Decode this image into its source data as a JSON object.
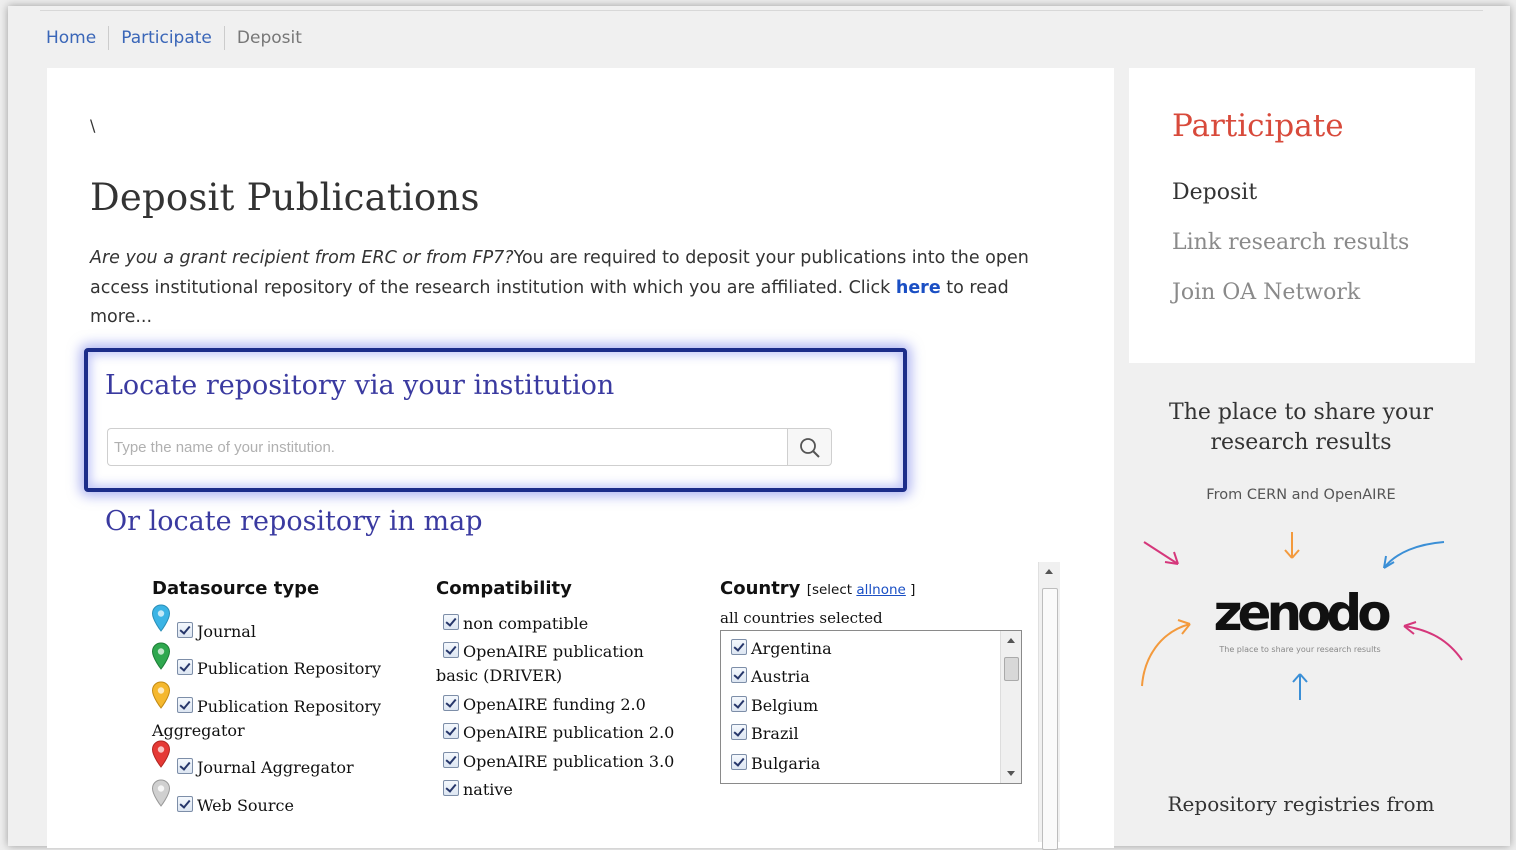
{
  "breadcrumb": {
    "home": "Home",
    "participate": "Participate",
    "current": "Deposit"
  },
  "main": {
    "stray_char": "\\",
    "title": "Deposit Publications",
    "intro_italic": "Are you a grant recipient from ERC or from FP7?",
    "intro_text": "You are required to deposit your publications into the open access institutional repository of the research institution with which you are affiliated. Click ",
    "intro_link": "here",
    "intro_tail": " to read more...",
    "locate_title": "Locate repository via your institution",
    "search_placeholder": "Type the name of your institution.",
    "map_title": "Or locate repository in map"
  },
  "filters": {
    "datasource": {
      "label": "Datasource type",
      "items": [
        "Journal",
        "Publication Repository",
        "Publication Repository",
        "Aggregator",
        "Journal Aggregator",
        "Web Source"
      ]
    },
    "compatibility": {
      "label": "Compatibility",
      "items": [
        "non compatible",
        "OpenAIRE publication",
        "basic (DRIVER)",
        "OpenAIRE funding 2.0",
        "OpenAIRE publication 2.0",
        "OpenAIRE publication 3.0",
        "native"
      ]
    },
    "country": {
      "label": "Country",
      "select_prefix": "[select ",
      "all": "all",
      "none": "none",
      "select_suffix": " ]",
      "status": "all countries selected",
      "items": [
        "Argentina",
        "Austria",
        "Belgium",
        "Brazil",
        "Bulgaria"
      ]
    },
    "pin_colors": [
      "#3bb4e5",
      "#2fa84f",
      "#f5b82e",
      "#e53935",
      "#d0d0d0"
    ]
  },
  "sidebar": {
    "title": "Participate",
    "links": [
      "Deposit",
      "Link research results",
      "Join OA Network"
    ],
    "promo_title": "The place to share your research results",
    "promo_sub": "From CERN and OpenAIRE",
    "zenodo_logo": "zenodo",
    "zenodo_tagline": "The place to share your research results",
    "bottom_text": "Repository registries from"
  },
  "colors": {
    "accent_red": "#d84a3b",
    "link_blue": "#1a4fc4",
    "highlight_navy": "#1c2d8a"
  }
}
